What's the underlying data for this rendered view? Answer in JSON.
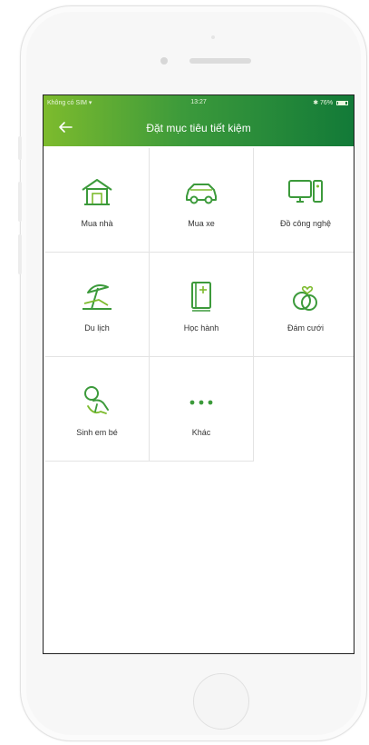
{
  "status_bar": {
    "carrier": "Không có SIM",
    "time": "13:27",
    "battery": "76%"
  },
  "nav": {
    "title": "Đặt mục tiêu tiết kiệm",
    "back_icon": "back-arrow-icon"
  },
  "goals": [
    {
      "label": "Mua nhà",
      "icon": "house-icon"
    },
    {
      "label": "Mua xe",
      "icon": "car-icon"
    },
    {
      "label": "Đồ công nghệ",
      "icon": "computer-icon"
    },
    {
      "label": "Du lịch",
      "icon": "beach-umbrella-icon"
    },
    {
      "label": "Học hành",
      "icon": "book-icon"
    },
    {
      "label": "Đám cưới",
      "icon": "rings-icon"
    },
    {
      "label": "Sinh em bé",
      "icon": "baby-icon"
    },
    {
      "label": "Khác",
      "icon": "more-dots-icon"
    }
  ],
  "colors": {
    "accent": "#3c9a3b",
    "gradient_start": "#7dbb2d",
    "gradient_end": "#127a38"
  }
}
